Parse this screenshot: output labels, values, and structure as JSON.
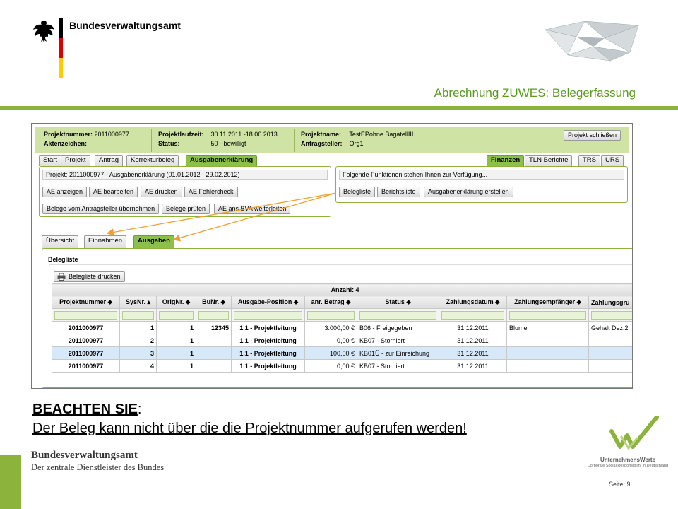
{
  "header": {
    "org_name": "Bundesverwaltungsamt",
    "slide_title": "Abrechnung ZUWES: Belegerfassung"
  },
  "project_header": {
    "projektnummer_label": "Projektnummer:",
    "projektnummer_value": "2011000977",
    "aktenzeichen_label": "Aktenzeichen:",
    "laufzeit_label": "Projektlaufzeit:",
    "laufzeit_value": "30.11.2011 -18.06.2013",
    "status_label": "Status:",
    "status_value": "50 - bewilligt",
    "projektname_label": "Projektname:",
    "projektname_value": "TestEPohne BagatellIII",
    "antragsteller_label": "Antragsteller:",
    "antragsteller_value": "Org1",
    "close_button": "Projekt schließen"
  },
  "main_tabs": [
    "Start",
    "Projekt",
    "Antrag",
    "Korrekturbeleg",
    "Ausgabenerklärung"
  ],
  "right_tabs": [
    "Finanzen",
    "TLN Berichte",
    "TRS",
    "URS"
  ],
  "left_panel": {
    "title": "Projekt: 2011000977 - Ausgabenerklärung (01.01.2012 - 29.02.2012)",
    "row1": [
      "AE anzeigen",
      "AE bearbeiten",
      "AE drucken",
      "AE Fehlercheck"
    ],
    "row2": [
      "Belege vom Antragsteller übernehmen",
      "Belege prüfen",
      "AE ans BVA weiterleiten"
    ]
  },
  "right_panel": {
    "title": "Folgende Funktionen stehen Ihnen zur Verfügung...",
    "buttons": [
      "Belegliste",
      "Berichtsliste",
      "Ausgabenerklärung erstellen"
    ]
  },
  "sub_tabs": [
    "Übersicht",
    "Einnahmen",
    "Ausgaben"
  ],
  "belegliste": {
    "title": "Belegliste",
    "print_button": "Belegliste drucken",
    "count_label": "Anzahl: 4",
    "columns": [
      "Projektnummer ⬥",
      "SysNr. ▴",
      "OrigNr. ⬥",
      "BuNr. ⬥",
      "Ausgabe-Position ⬥",
      "anr. Betrag ⬥",
      "Status ⬥",
      "Zahlungsdatum ⬥",
      "Zahlungsempfänger ⬥",
      "Zahlungsgru"
    ],
    "rows": [
      [
        "2011000977",
        "1",
        "1",
        "12345",
        "1.1 - Projektleitung",
        "3.000,00 €",
        "B06 - Freigegeben",
        "31.12.2011",
        "Blume",
        "Gehalt Dez.2"
      ],
      [
        "2011000977",
        "2",
        "1",
        "",
        "1.1 - Projektleitung",
        "0,00 €",
        "KB07 - Storniert",
        "31.12.2011",
        "",
        ""
      ],
      [
        "2011000977",
        "3",
        "1",
        "",
        "1.1 - Projektleitung",
        "100,00 €",
        "KB01Ü - zur Einreichung",
        "31.12.2011",
        "",
        ""
      ],
      [
        "2011000977",
        "4",
        "1",
        "",
        "1.1 - Projektleitung",
        "0,00 €",
        "KB07 - Storniert",
        "31.12.2011",
        "",
        ""
      ]
    ]
  },
  "note": {
    "line1": "BEACHTEN SIE",
    "line1_suffix": ":",
    "line2": "Der Beleg kann nicht über die die Projektnummer aufgerufen werden!"
  },
  "footer": {
    "org_name": "Bundesverwaltungsamt",
    "org_sub": "Der zentrale Dienstleister des Bundes",
    "uw_name": "UnternehmensWerte",
    "uw_sub": "Corporate Social Responsibility in Deutschland",
    "page": "Seite: 9"
  },
  "colors": {
    "accent_green": "#8cb43c",
    "title_green": "#5a9a1e",
    "header_green": "#cfe3a4",
    "selected_row": "#d7e8f8",
    "arrow_orange": "#f0a030"
  }
}
